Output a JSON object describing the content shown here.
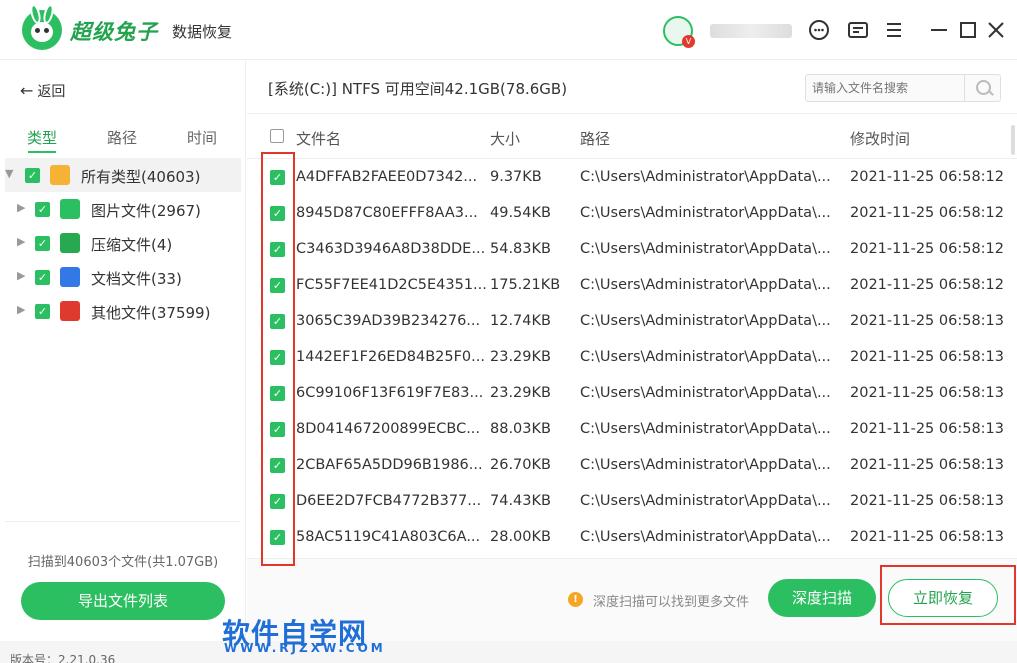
{
  "app": {
    "brand_name": "超级兔子",
    "product_name": "数据恢复",
    "version_label": "版本号：2.21.0.36"
  },
  "titlebar_icons": [
    "customer-service-icon",
    "message-icon",
    "menu-icon",
    "minimize-icon",
    "maximize-icon",
    "close-icon"
  ],
  "sidebar": {
    "back_label": "返回",
    "tabs": [
      {
        "label": "类型",
        "active": true
      },
      {
        "label": "路径",
        "active": false
      },
      {
        "label": "时间",
        "active": false
      }
    ],
    "tree": [
      {
        "label": "所有类型(40603)",
        "icon": "folder-icon",
        "color": "#f5b335",
        "checked": true,
        "selected": true
      },
      {
        "label": "图片文件(2967)",
        "icon": "image-file-icon",
        "color": "#2cbf62",
        "checked": true
      },
      {
        "label": "压缩文件(4)",
        "icon": "zip-file-icon",
        "color": "#26a94f",
        "checked": true
      },
      {
        "label": "文档文件(33)",
        "icon": "document-file-icon",
        "color": "#3478e5",
        "checked": true
      },
      {
        "label": "其他文件(37599)",
        "icon": "other-file-icon",
        "color": "#e03a2e",
        "checked": true
      }
    ],
    "scan_summary": "扫描到40603个文件(共1.07GB)",
    "export_label": "导出文件列表"
  },
  "main": {
    "disk_info": "[系统(C:)] NTFS 可用空间42.1GB(78.6GB)",
    "search_placeholder": "请输入文件名搜索",
    "columns": {
      "name": "文件名",
      "size": "大小",
      "path": "路径",
      "modified": "修改时间"
    },
    "rows": [
      {
        "name": "A4DFFAB2FAEE0D7342...",
        "size": "9.37KB",
        "path": "C:\\Users\\Administrator\\AppData\\...",
        "modified": "2021-11-25 06:58:12",
        "checked": true
      },
      {
        "name": "8945D87C80EFFF8AA3...",
        "size": "49.54KB",
        "path": "C:\\Users\\Administrator\\AppData\\...",
        "modified": "2021-11-25 06:58:12",
        "checked": true
      },
      {
        "name": "C3463D3946A8D38DDE...",
        "size": "54.83KB",
        "path": "C:\\Users\\Administrator\\AppData\\...",
        "modified": "2021-11-25 06:58:12",
        "checked": true
      },
      {
        "name": "FC55F7EE41D2C5E4351...",
        "size": "175.21KB",
        "path": "C:\\Users\\Administrator\\AppData\\...",
        "modified": "2021-11-25 06:58:12",
        "checked": true
      },
      {
        "name": "3065C39AD39B234276...",
        "size": "12.74KB",
        "path": "C:\\Users\\Administrator\\AppData\\...",
        "modified": "2021-11-25 06:58:13",
        "checked": true
      },
      {
        "name": "1442EF1F26ED84B25F0...",
        "size": "23.29KB",
        "path": "C:\\Users\\Administrator\\AppData\\...",
        "modified": "2021-11-25 06:58:13",
        "checked": true
      },
      {
        "name": "6C99106F13F619F7E83...",
        "size": "23.29KB",
        "path": "C:\\Users\\Administrator\\AppData\\...",
        "modified": "2021-11-25 06:58:13",
        "checked": true
      },
      {
        "name": "8D041467200899ECBC...",
        "size": "88.03KB",
        "path": "C:\\Users\\Administrator\\AppData\\...",
        "modified": "2021-11-25 06:58:13",
        "checked": true
      },
      {
        "name": "2CBAF65A5DD96B1986...",
        "size": "26.70KB",
        "path": "C:\\Users\\Administrator\\AppData\\...",
        "modified": "2021-11-25 06:58:13",
        "checked": true
      },
      {
        "name": "D6EE2D7FCB4772B377...",
        "size": "74.43KB",
        "path": "C:\\Users\\Administrator\\AppData\\...",
        "modified": "2021-11-25 06:58:13",
        "checked": true
      },
      {
        "name": "58AC5119C41A803C6A...",
        "size": "28.00KB",
        "path": "C:\\Users\\Administrator\\AppData\\...",
        "modified": "2021-11-25 06:58:13",
        "checked": true
      }
    ],
    "deep_scan_tip": "深度扫描可以找到更多文件",
    "deep_scan_label": "深度扫描",
    "recover_label": "立即恢复"
  },
  "watermark": {
    "title": "软件自学网",
    "url": "WWW.RJZXW.COM"
  },
  "colors": {
    "accent": "#2cbf62",
    "annotation": "#e0362c",
    "watermark": "#1f6fd6"
  }
}
